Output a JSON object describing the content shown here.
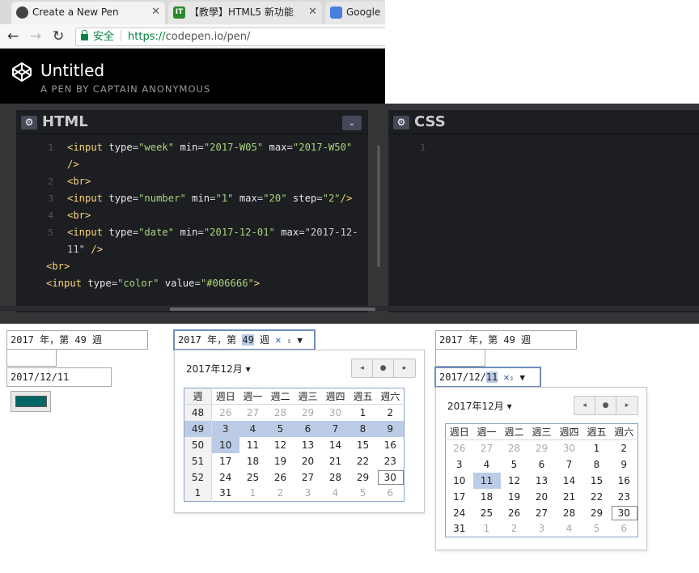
{
  "browser": {
    "tabs": [
      {
        "title": "Create a New Pen",
        "icon": "codepen-icon"
      },
      {
        "title": "【教學】HTML5 新功能",
        "icon": "it-site-icon"
      },
      {
        "title": "Google",
        "icon": "google-translate-icon"
      }
    ],
    "secure_label": "安全",
    "url_protocol": "https://",
    "url_rest": "codepen.io/pen/"
  },
  "pen": {
    "title": "Untitled",
    "subtitle": "A PEN BY CAPTAIN ANONYMOUS"
  },
  "html_panel": {
    "title": "HTML",
    "lines": [
      {
        "num": "1",
        "code": "<input type=\"week\" min=\"2017-W05\" max=\"2017-W50\""
      },
      {
        "num": "",
        "code": "/>"
      },
      {
        "num": "2",
        "code": "<br>"
      },
      {
        "num": "3",
        "code": "<input type=\"number\" min=\"1\" max=\"20\" step=\"2\"/>"
      },
      {
        "num": "4",
        "code": "<br>"
      },
      {
        "num": "5",
        "code": "<input type=\"date\" min=\"2017-12-01\" max=\"2017-12-"
      },
      {
        "num": "",
        "code": "11\" />"
      },
      {
        "num": "",
        "code": "<br>"
      },
      {
        "num": "",
        "code": "<input type=\"color\" value=\"#006666\">"
      }
    ]
  },
  "css_panel": {
    "title": "CSS",
    "line_num": "1"
  },
  "preview_left": {
    "week_value": "2017 年，第 49 週",
    "date_value": "2017/12/11",
    "color_value": "#006666"
  },
  "week_picker": {
    "text_year": "2017 年，第 ",
    "text_week": "49",
    "text_suffix": " 週",
    "month_label": "2017年12月 ▾",
    "nav": [
      "◂",
      "●",
      "▸"
    ],
    "header": [
      "週",
      "週日",
      "週一",
      "週二",
      "週三",
      "週四",
      "週五",
      "週六"
    ],
    "rows": [
      [
        "48",
        "26",
        "27",
        "28",
        "29",
        "30",
        "1",
        "2"
      ],
      [
        "49",
        "3",
        "4",
        "5",
        "6",
        "7",
        "8",
        "9"
      ],
      [
        "50",
        "10",
        "11",
        "12",
        "13",
        "14",
        "15",
        "16"
      ],
      [
        "51",
        "17",
        "18",
        "19",
        "20",
        "21",
        "22",
        "23"
      ],
      [
        "52",
        "24",
        "25",
        "26",
        "27",
        "28",
        "29",
        "30"
      ],
      [
        "1",
        "31",
        "1",
        "2",
        "3",
        "4",
        "5",
        "6"
      ]
    ]
  },
  "date_picker": {
    "week_value": "2017 年，第 49 週",
    "date_prefix": "2017/12/",
    "date_day": "11",
    "month_label": "2017年12月 ▾",
    "nav": [
      "◂",
      "●",
      "▸"
    ],
    "header": [
      "週日",
      "週一",
      "週二",
      "週三",
      "週四",
      "週五",
      "週六"
    ],
    "rows": [
      [
        "26",
        "27",
        "28",
        "29",
        "30",
        "1",
        "2"
      ],
      [
        "3",
        "4",
        "5",
        "6",
        "7",
        "8",
        "9"
      ],
      [
        "10",
        "11",
        "12",
        "13",
        "14",
        "15",
        "16"
      ],
      [
        "17",
        "18",
        "19",
        "20",
        "21",
        "22",
        "23"
      ],
      [
        "24",
        "25",
        "26",
        "27",
        "28",
        "29",
        "30"
      ],
      [
        "31",
        "1",
        "2",
        "3",
        "4",
        "5",
        "6"
      ]
    ]
  }
}
